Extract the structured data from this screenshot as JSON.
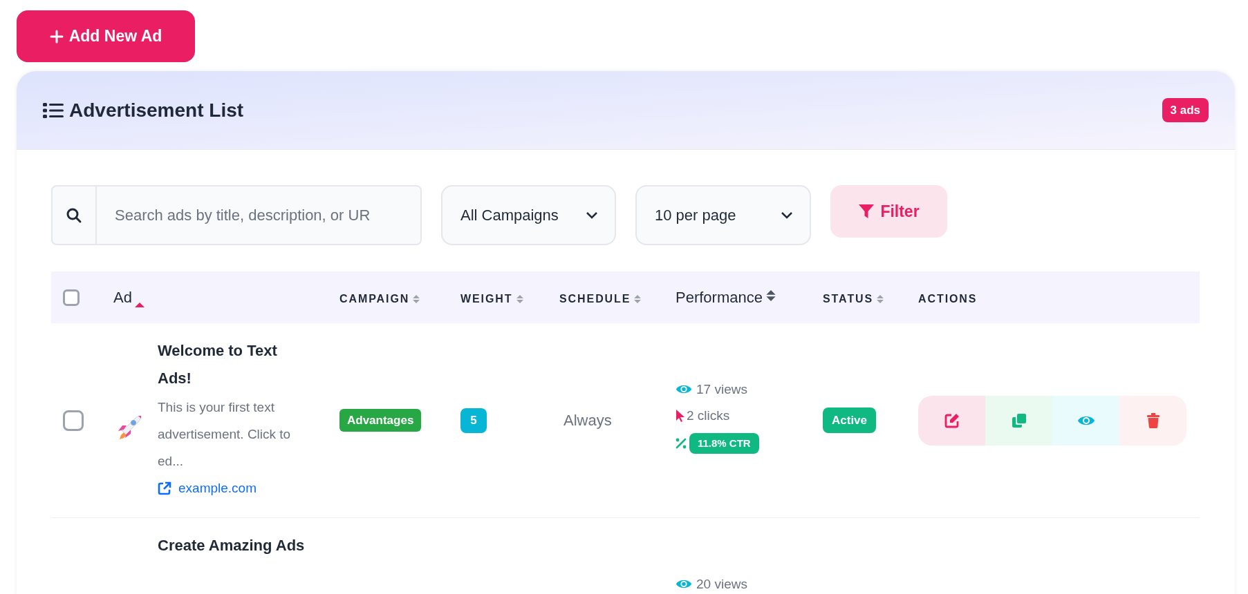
{
  "add_button": {
    "label": "Add New Ad"
  },
  "card": {
    "title": "Advertisement List",
    "count_badge": "3 ads"
  },
  "toolbar": {
    "search": {
      "placeholder": "Search ads by title, description, or UR"
    },
    "campaign_select": {
      "value": "All Campaigns"
    },
    "per_page_select": {
      "value": "10 per page"
    },
    "filter_button": {
      "label": "Filter"
    }
  },
  "table": {
    "select_all": {
      "checked": false
    },
    "columns": [
      {
        "label": "Ad",
        "kind": "plain",
        "sortable": true,
        "sorted_ascending": true
      },
      {
        "label": "CAMPAIGN",
        "kind": "caps",
        "sortable": true,
        "sorted_ascending": false
      },
      {
        "label": "WEIGHT",
        "kind": "caps",
        "sortable": true,
        "sorted_ascending": false
      },
      {
        "label": "SCHEDULE",
        "kind": "caps",
        "sortable": true,
        "sorted_ascending": false
      },
      {
        "label": "Performance",
        "kind": "plain",
        "sortable": true,
        "sorted_ascending": false
      },
      {
        "label": "STATUS",
        "kind": "caps",
        "sortable": true,
        "sorted_ascending": false
      },
      {
        "label": "ACTIONS",
        "kind": "caps",
        "sortable": false
      }
    ],
    "rows": [
      {
        "checked": false,
        "title": "Welcome to Text Ads!",
        "description": "This is your first text advertisement. Click to ed...",
        "url": "example.com",
        "campaign": "Advantages",
        "weight": "5",
        "schedule": "Always",
        "views": "17 views",
        "clicks": "2 clicks",
        "ctr": "11.8% CTR",
        "status": "Active"
      },
      {
        "title": "Create Amazing Ads",
        "views": "20 views"
      }
    ]
  }
}
